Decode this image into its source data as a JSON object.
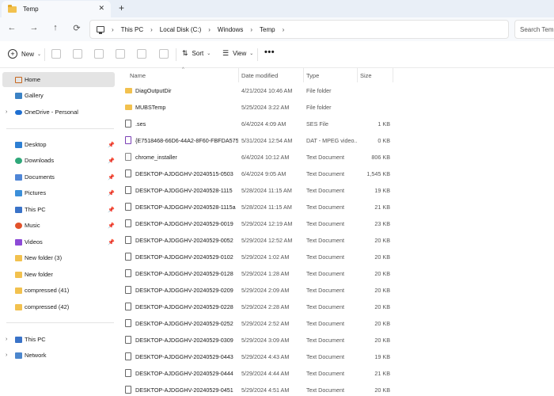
{
  "tab": {
    "title": "Temp",
    "close": "✕",
    "new_tab": "+"
  },
  "nav": {
    "back": "←",
    "forward": "→",
    "up": "↑",
    "refresh": "⟳"
  },
  "breadcrumb": {
    "separator": "›",
    "items": [
      "This PC",
      "Local Disk (C:)",
      "Windows",
      "Temp"
    ]
  },
  "search": {
    "placeholder": "Search Temp"
  },
  "toolbar": {
    "new_label": "New",
    "sort_label": "Sort",
    "view_label": "View",
    "more_label": "•••",
    "chevron": "⌄"
  },
  "sidebar": {
    "items": [
      {
        "label": "Home",
        "icon": "home-icon"
      },
      {
        "label": "Gallery",
        "icon": "gallery-icon"
      },
      {
        "label": "OneDrive - Personal",
        "icon": "onedrive-icon"
      },
      {
        "label": "Desktop",
        "icon": "desktop-icon"
      },
      {
        "label": "Downloads",
        "icon": "downloads-icon"
      },
      {
        "label": "Documents",
        "icon": "documents-icon"
      },
      {
        "label": "Pictures",
        "icon": "pictures-icon"
      },
      {
        "label": "This PC",
        "icon": "this-pc-icon"
      },
      {
        "label": "Music",
        "icon": "music-icon"
      },
      {
        "label": "Videos",
        "icon": "videos-icon"
      },
      {
        "label": "New folder (3)",
        "icon": "folder-icon"
      },
      {
        "label": "New folder",
        "icon": "folder-icon"
      },
      {
        "label": "compressed (41)",
        "icon": "folder-icon"
      },
      {
        "label": "compressed (42)",
        "icon": "folder-icon"
      },
      {
        "label": "This PC",
        "icon": "this-pc-icon"
      },
      {
        "label": "Network",
        "icon": "network-icon"
      }
    ],
    "expand_glyph": "›",
    "pin_glyph": "📌"
  },
  "columns": {
    "name": "Name",
    "date": "Date modified",
    "type": "Type",
    "size": "Size"
  },
  "files": [
    {
      "name": "DiagOutputDir",
      "date": "4/21/2024 10:46 AM",
      "type": "File folder",
      "size": "",
      "kind": "folder"
    },
    {
      "name": "MUBSTemp",
      "date": "5/25/2024 3:22 AM",
      "type": "File folder",
      "size": "",
      "kind": "folder"
    },
    {
      "name": ".ses",
      "date": "6/4/2024 4:09 AM",
      "type": "SES File",
      "size": "1 KB",
      "kind": "doc"
    },
    {
      "name": "{E7518468-66D6-44A2-8F60-FBFDA5757...",
      "date": "5/31/2024 12:54 AM",
      "type": "DAT - MPEG video...",
      "size": "0 KB",
      "kind": "media"
    },
    {
      "name": "chrome_installer",
      "date": "6/4/2024 10:12 AM",
      "type": "Text Document",
      "size": "806 KB",
      "kind": "installer"
    },
    {
      "name": "DESKTOP-AJDGGHV-20240515-0503",
      "date": "6/4/2024 9:05 AM",
      "type": "Text Document",
      "size": "1,545 KB",
      "kind": "doc"
    },
    {
      "name": "DESKTOP-AJDGGHV-20240528-1115",
      "date": "5/28/2024 11:15 AM",
      "type": "Text Document",
      "size": "19 KB",
      "kind": "doc"
    },
    {
      "name": "DESKTOP-AJDGGHV-20240528-1115a",
      "date": "5/28/2024 11:15 AM",
      "type": "Text Document",
      "size": "21 KB",
      "kind": "doc"
    },
    {
      "name": "DESKTOP-AJDGGHV-20240529-0019",
      "date": "5/29/2024 12:19 AM",
      "type": "Text Document",
      "size": "23 KB",
      "kind": "doc"
    },
    {
      "name": "DESKTOP-AJDGGHV-20240529-0052",
      "date": "5/29/2024 12:52 AM",
      "type": "Text Document",
      "size": "20 KB",
      "kind": "doc"
    },
    {
      "name": "DESKTOP-AJDGGHV-20240529-0102",
      "date": "5/29/2024 1:02 AM",
      "type": "Text Document",
      "size": "20 KB",
      "kind": "doc"
    },
    {
      "name": "DESKTOP-AJDGGHV-20240529-0128",
      "date": "5/29/2024 1:28 AM",
      "type": "Text Document",
      "size": "20 KB",
      "kind": "doc"
    },
    {
      "name": "DESKTOP-AJDGGHV-20240529-0209",
      "date": "5/29/2024 2:09 AM",
      "type": "Text Document",
      "size": "20 KB",
      "kind": "doc"
    },
    {
      "name": "DESKTOP-AJDGGHV-20240529-0228",
      "date": "5/29/2024 2:28 AM",
      "type": "Text Document",
      "size": "20 KB",
      "kind": "doc"
    },
    {
      "name": "DESKTOP-AJDGGHV-20240529-0252",
      "date": "5/29/2024 2:52 AM",
      "type": "Text Document",
      "size": "20 KB",
      "kind": "doc"
    },
    {
      "name": "DESKTOP-AJDGGHV-20240529-0309",
      "date": "5/29/2024 3:09 AM",
      "type": "Text Document",
      "size": "20 KB",
      "kind": "doc"
    },
    {
      "name": "DESKTOP-AJDGGHV-20240529-0443",
      "date": "5/29/2024 4:43 AM",
      "type": "Text Document",
      "size": "19 KB",
      "kind": "doc"
    },
    {
      "name": "DESKTOP-AJDGGHV-20240529-0444",
      "date": "5/29/2024 4:44 AM",
      "type": "Text Document",
      "size": "21 KB",
      "kind": "doc"
    },
    {
      "name": "DESKTOP-AJDGGHV-20240529-0451",
      "date": "5/29/2024 4:51 AM",
      "type": "Text Document",
      "size": "20 KB",
      "kind": "doc"
    }
  ]
}
